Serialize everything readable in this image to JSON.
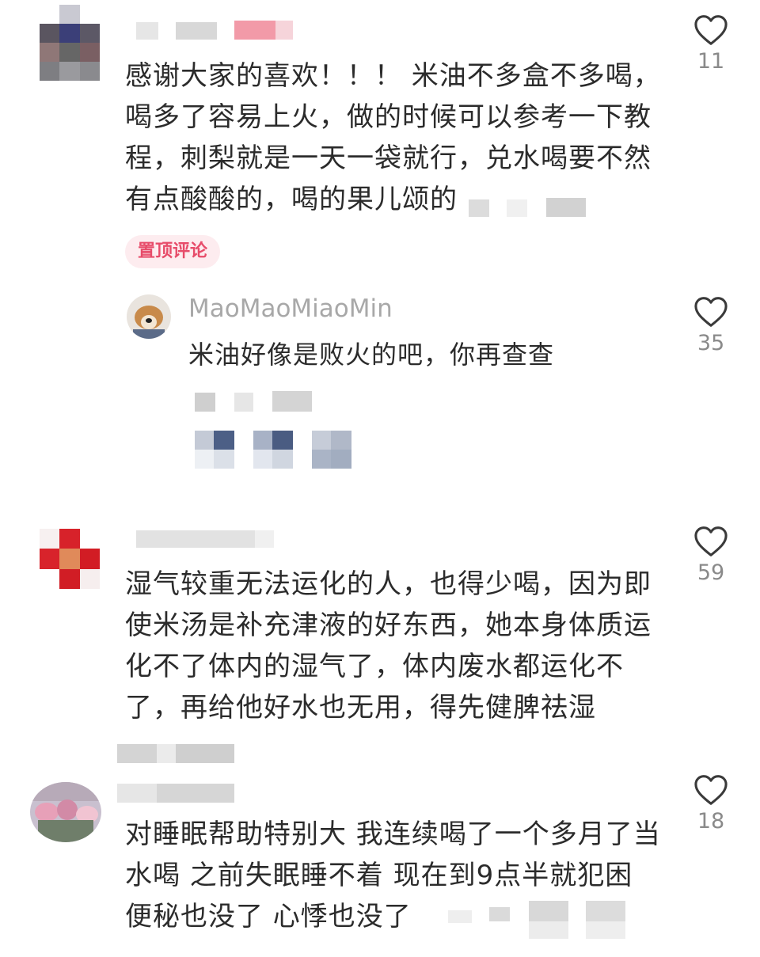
{
  "comments": [
    {
      "text": "感谢大家的喜欢！！！ 米油不多盒不多喝，喝多了容易上火，做的时候可以参考一下教程，刺梨就是一天一袋就行，兑水喝要不然有点酸酸的，喝的果儿颂的",
      "likes": "11",
      "pin_label": "置顶评论"
    },
    {
      "text": "湿气较重无法运化的人，也得少喝，因为即使米汤是补充津液的好东西，她本身体质运化不了体内的湿气了，体内废水都运化不了，再给他好水也无用，得先健脾祛湿",
      "likes": "59"
    },
    {
      "text": "对睡眠帮助特别大 我连续喝了一个多月了当水喝 之前失眠睡不着 现在到9点半就犯困 便秘也没了 心悸也没了",
      "likes": "18"
    }
  ],
  "reply": {
    "username": "MaoMaoMiaoMin",
    "text": "米油好像是败火的吧，你再查查",
    "likes": "35"
  },
  "icons": {
    "like": "heart-outline-icon"
  },
  "colors": {
    "pin_bg": "#fdecef",
    "pin_text": "#e74c6a",
    "count": "#8a8a8a"
  }
}
